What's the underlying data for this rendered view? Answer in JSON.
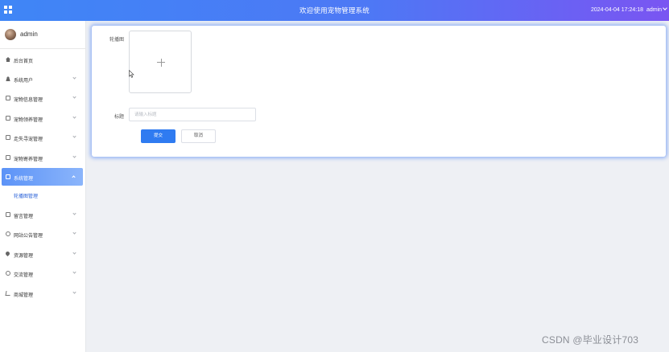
{
  "header": {
    "title": "欢迎使用宠物管理系统",
    "datetime": "2024-04-04 17:24:18",
    "user": "admin"
  },
  "sidebar": {
    "username": "admin",
    "items": [
      {
        "label": "后台首页",
        "icon": "home-icon",
        "expandable": false
      },
      {
        "label": "系统用户",
        "icon": "user-icon",
        "expandable": true
      },
      {
        "label": "宠物信息管理",
        "icon": "document-icon",
        "expandable": true
      },
      {
        "label": "宠物领养管理",
        "icon": "document-icon",
        "expandable": true
      },
      {
        "label": "走失寻宠管理",
        "icon": "document-icon",
        "expandable": true
      },
      {
        "label": "宠物寄养管理",
        "icon": "document-icon",
        "expandable": true
      },
      {
        "label": "系统管理",
        "icon": "image-icon",
        "expandable": true,
        "active": true
      },
      {
        "label": "轮播图管理",
        "sub": true
      },
      {
        "label": "留言管理",
        "icon": "image-icon",
        "expandable": true
      },
      {
        "label": "网站公告管理",
        "icon": "info-icon",
        "expandable": true
      },
      {
        "label": "资源管理",
        "icon": "location-icon",
        "expandable": true
      },
      {
        "label": "交流管理",
        "icon": "chat-icon",
        "expandable": true
      },
      {
        "label": "商城管理",
        "icon": "cart-icon",
        "expandable": true
      }
    ]
  },
  "form": {
    "carousel_label": "轮播图",
    "title_label": "标题",
    "title_placeholder": "请输入标题",
    "title_value": "",
    "submit_label": "提交",
    "cancel_label": "取消"
  },
  "watermark": "CSDN @毕业设计703",
  "colors": {
    "header_gradient_start": "#3f86f6",
    "header_gradient_end": "#7a55f2",
    "active_menu": "#5c93f7",
    "primary_button": "#2f7bf1",
    "focus_glow": "#78a0f5"
  }
}
